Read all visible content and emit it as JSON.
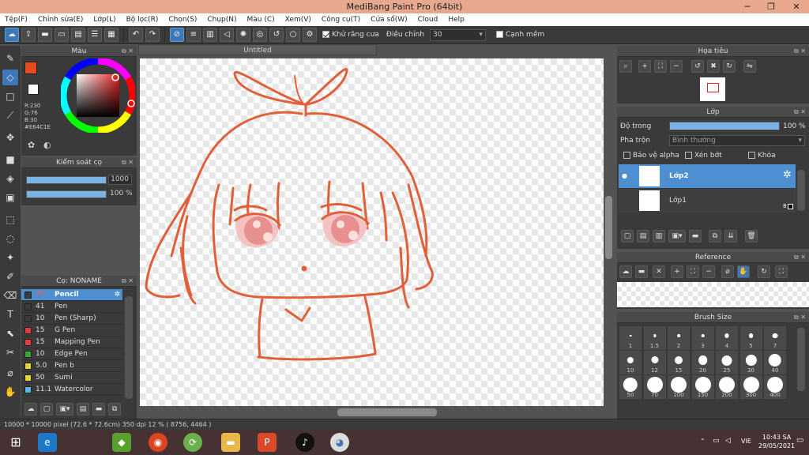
{
  "window": {
    "title": "MediBang Paint Pro (64bit)"
  },
  "menu": [
    "Tệp(F)",
    "Chỉnh sửa(E)",
    "Lớp(L)",
    "Bộ lọc(R)",
    "Chọn(S)",
    "Chụp(N)",
    "Màu (C)",
    "Xem(V)",
    "Công cụ(T)",
    "Cửa sổ(W)",
    "Cloud",
    "Help"
  ],
  "toolbar": {
    "antialias_label": "Khử răng cưa",
    "antialias_checked": true,
    "stabilizer_label": "Điều chỉnh",
    "stabilizer_value": "30",
    "snap_label": "Cạnh mềm",
    "snap_checked": false
  },
  "color_panel": {
    "title": "Màu",
    "r": "R:230",
    "g": "G:76",
    "b": "B:30",
    "hex": "#E64C1E",
    "primary_color": "#e64c1e",
    "secondary_color": "#ffffff"
  },
  "brush_control": {
    "title": "Kiểm soát cọ",
    "size_value": "1000",
    "opacity_value": "100 %",
    "size_fraction": 1.0,
    "opacity_fraction": 1.0
  },
  "brush_list": {
    "title": "Cọ: NONAME",
    "items": [
      {
        "size": "70",
        "name": "Pencil",
        "color": "#3a3a3a",
        "selected": true
      },
      {
        "size": "41",
        "name": "Pen",
        "color": "#3a3a3a"
      },
      {
        "size": "10",
        "name": "Pen (Sharp)",
        "color": "#3a3a3a"
      },
      {
        "size": "15",
        "name": "G Pen",
        "color": "#e53a3a"
      },
      {
        "size": "15",
        "name": "Mapping Pen",
        "color": "#e53a3a"
      },
      {
        "size": "10",
        "name": "Edge Pen",
        "color": "#3aa63a"
      },
      {
        "size": "5.0",
        "name": "Pen b",
        "color": "#e6d23a"
      },
      {
        "size": "50",
        "name": "Sumi",
        "color": "#e6d23a"
      },
      {
        "size": "11.1",
        "name": "Watercolor",
        "color": "#5ab4e6"
      }
    ]
  },
  "document": {
    "tab_title": "Untitled"
  },
  "navigator": {
    "title": "Họa tiêu"
  },
  "layers": {
    "title": "Lớp",
    "opacity_label": "Độ trong",
    "opacity_value": "100 %",
    "opacity_fraction": 1.0,
    "blend_label": "Pha trộn",
    "blend_value": "Bình thường",
    "protect_alpha": "Bảo vệ alpha",
    "clipping": "Xén bớt",
    "lock": "Khóa",
    "items": [
      {
        "name": "Lớp2",
        "selected": true
      },
      {
        "name": "Lớp1",
        "selected": false,
        "badge": "8"
      }
    ]
  },
  "reference": {
    "title": "Reference"
  },
  "brush_size": {
    "title": "Brush Size",
    "sizes": [
      "1",
      "1.5",
      "2",
      "3",
      "4",
      "5",
      "7",
      "10",
      "12",
      "15",
      "20",
      "25",
      "30",
      "40",
      "50",
      "70",
      "100",
      "150",
      "200",
      "300",
      "400"
    ]
  },
  "status": {
    "text": "10000 * 10000 pixel   (72.6 * 72.6cm)   350 dpi   12 %   ( 8756, 4464 )"
  },
  "taskbar": {
    "lang": "VIE",
    "time": "10:43 SA",
    "date": "29/05/2021"
  },
  "colors": {
    "accent": "#3d79b8",
    "stroke": "#e0603a",
    "eye": "#e89090"
  }
}
